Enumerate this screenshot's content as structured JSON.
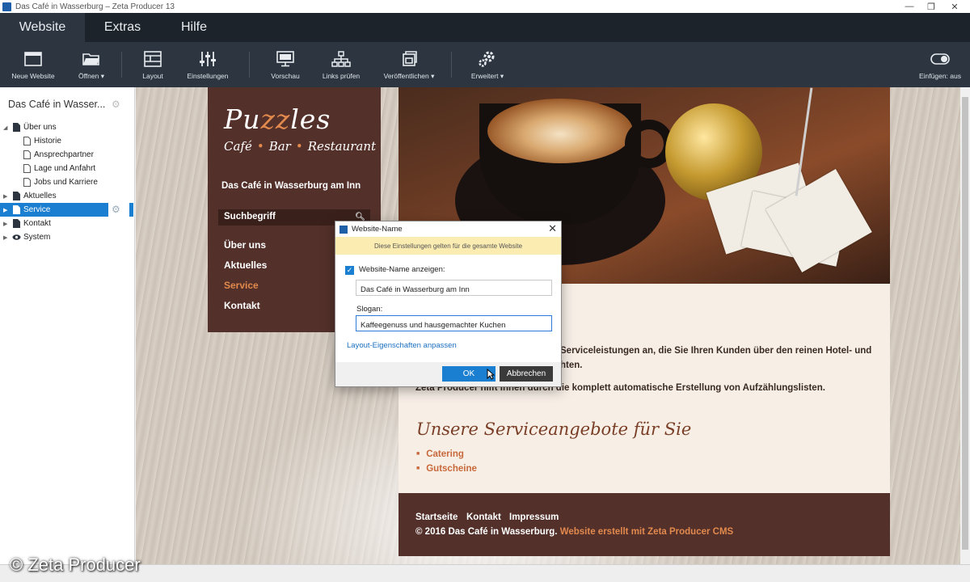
{
  "window": {
    "title": "Das Café in Wasserburg – Zeta Producer 13",
    "minimize": "—",
    "maximize": "❐",
    "close": "✕"
  },
  "ribbon": {
    "tabs": [
      {
        "label": "Website",
        "active": true
      },
      {
        "label": "Extras",
        "active": false
      },
      {
        "label": "Hilfe",
        "active": false
      }
    ]
  },
  "toolbar": {
    "new_website": "Neue Website",
    "open": "Öffnen",
    "layout": "Layout",
    "settings": "Einstellungen",
    "preview": "Vorschau",
    "check_links": "Links prüfen",
    "publish": "Veröffentlichen",
    "advanced": "Erweitert",
    "insert_toggle": "Einfügen: aus",
    "dropdown_arrow": "▾"
  },
  "sidebar": {
    "site_title": "Das Café in Wasser...",
    "tree": [
      {
        "label": "Über uns",
        "level": 0,
        "expanded": true
      },
      {
        "label": "Historie",
        "level": 1
      },
      {
        "label": "Ansprechpartner",
        "level": 1
      },
      {
        "label": "Lage und Anfahrt",
        "level": 1
      },
      {
        "label": "Jobs und Karriere",
        "level": 1
      },
      {
        "label": "Aktuelles",
        "level": 0
      },
      {
        "label": "Service",
        "level": 0,
        "selected": true
      },
      {
        "label": "Kontakt",
        "level": 0
      },
      {
        "label": "System",
        "level": 0
      }
    ]
  },
  "site": {
    "logo_title_start": "Pu",
    "logo_title_accent": "zz",
    "logo_title_end": "les",
    "logo_sub_1": "Café",
    "logo_sub_2": "Bar",
    "logo_sub_3": "Restaurant",
    "logo_sub_sep": "•",
    "site_name": "Das Café in Wasserburg am Inn",
    "search_placeholder": "Suchbegriff",
    "nav": [
      {
        "label": "Über uns"
      },
      {
        "label": "Aktuelles"
      },
      {
        "label": "Service",
        "active": true
      },
      {
        "label": "Kontakt"
      }
    ],
    "body_line_1": "Serviceleistungen an, die Sie Ihren Kunden über den reinen Hotel- und",
    "body_line_2": "hten.",
    "body_line_3": "Zeta Producer hilft Ihnen durch die komplett automatische Erstellung von Aufzählungslisten.",
    "services_heading": "Unsere Serviceangebote für Sie",
    "services": [
      "Catering",
      "Gutscheine"
    ],
    "footer_links": [
      "Startseite",
      "Kontakt",
      "Impressum"
    ],
    "footer_copy": "© 2016 Das Café in Wasserburg.",
    "footer_cms": "Website erstellt mit Zeta Producer CMS"
  },
  "dialog": {
    "title": "Website-Name",
    "close": "✕",
    "info": "Diese Einstellungen gelten für die gesamte Website",
    "show_name_label": "Website-Name anzeigen:",
    "show_name_checked": true,
    "name_value": "Das Café in Wasserburg am Inn",
    "slogan_label": "Slogan:",
    "slogan_value": "Kaffeegenuss und hausgemachter Kuchen",
    "layout_link": "Layout-Eigenschaften anpassen",
    "ok": "OK",
    "cancel": "Abbrechen"
  },
  "watermark": "© Zeta Producer",
  "colors": {
    "accent_blue": "#1a7fd0",
    "brand_brown": "#53302a",
    "accent_orange": "#e2894d"
  }
}
